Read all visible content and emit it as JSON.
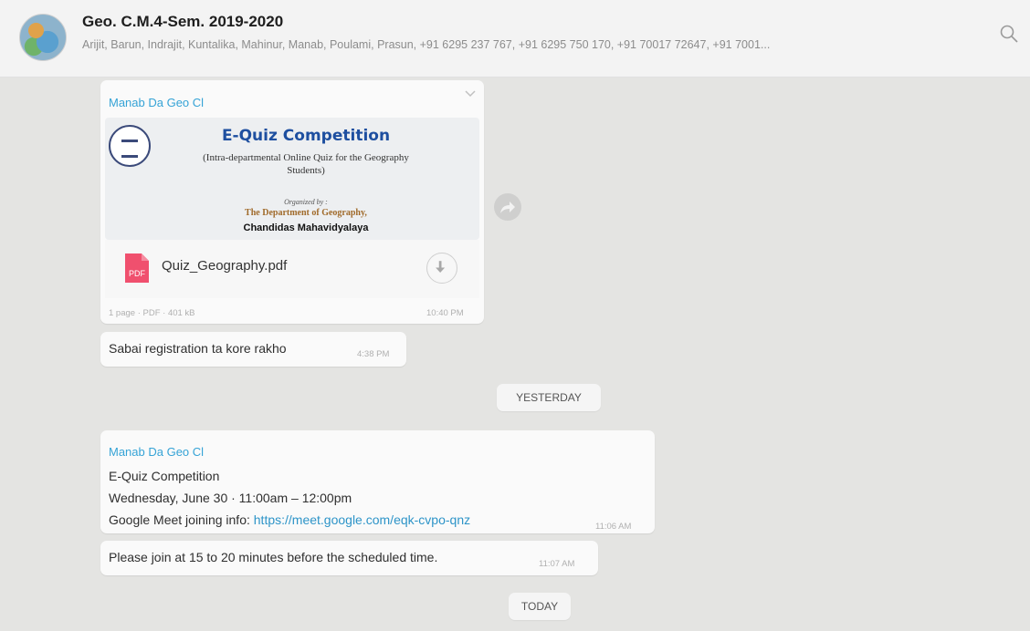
{
  "header": {
    "title": "Geo. C.M.4-Sem. 2019-2020",
    "participants": "Arijit, Barun, Indrajit, Kuntalika, Mahinur, Manab, Poulami, Prasun, +91 6295 237 767, +91 6295 750 170, +91 70017 72647, +91 7001..."
  },
  "document_message": {
    "sender": "Manab Da Geo Cl",
    "preview": {
      "title": "E-Quiz Competition",
      "subtitle_line1": "(Intra-departmental Online Quiz for the Geography",
      "subtitle_line2": "Students)",
      "organized_by": "Organized by :",
      "department": "The Department of Geography,",
      "college": "Chandidas Mahavidyalaya"
    },
    "pdf_badge": "PDF",
    "filename": "Quiz_Geography.pdf",
    "meta": "1 page · PDF · 401 kB",
    "time": "10:40 PM"
  },
  "message_1": {
    "text": "Sabai registration ta kore rakho",
    "time": "4:38 PM"
  },
  "date_yesterday": "YESTERDAY",
  "event_message": {
    "sender": "Manab Da Geo Cl",
    "line1": "E-Quiz Competition",
    "line2": "Wednesday, June 30 · 11:00am – 12:00pm",
    "line3_prefix": "Google Meet joining info: ",
    "link": "https://meet.google.com/eqk-cvpo-qnz",
    "time": "11:06 AM"
  },
  "message_2": {
    "text": "Please join at 15 to 20 minutes before the scheduled time.",
    "time": "11:07 AM"
  },
  "date_today": "TODAY",
  "colors": {
    "sender": "#35a3d6",
    "link": "#2d94c8",
    "pdf_icon": "#f0506e"
  },
  "icons": [
    "search-icon",
    "chevron-down-icon",
    "pdf-file-icon",
    "download-icon",
    "forward-icon"
  ]
}
